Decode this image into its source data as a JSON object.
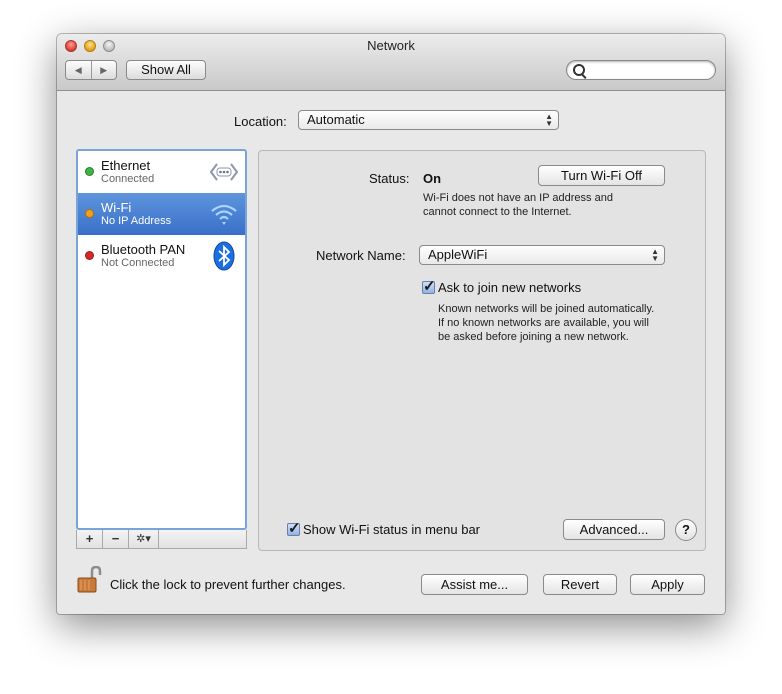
{
  "window": {
    "title": "Network",
    "nav_back": "◀",
    "nav_forward": "▶",
    "show_all_label": "Show All",
    "search_placeholder": ""
  },
  "location": {
    "label": "Location:",
    "value": "Automatic"
  },
  "services": [
    {
      "name": "Ethernet",
      "status": "Connected",
      "status_color": "#3fb33f",
      "icon": "ethernet-icon",
      "selected": false
    },
    {
      "name": "Wi-Fi",
      "status": "No IP Address",
      "status_color": "#f0a020",
      "icon": "wifi-icon",
      "selected": true
    },
    {
      "name": "Bluetooth PAN",
      "status": "Not Connected",
      "status_color": "#d62828",
      "icon": "bluetooth-icon",
      "selected": false
    }
  ],
  "list_toolbar": {
    "add": "+",
    "remove": "−",
    "action": "✲▾"
  },
  "detail": {
    "status_label": "Status:",
    "status_value": "On",
    "turn_off_label": "Turn Wi-Fi Off",
    "status_description_1": "Wi-Fi does not have an IP address and",
    "status_description_2": "cannot connect to the Internet.",
    "network_name_label": "Network Name:",
    "network_name_value": "AppleWiFi",
    "ask_join_label": "Ask to join new networks",
    "ask_join_checked": true,
    "ask_join_desc_1": "Known networks will be joined automatically.",
    "ask_join_desc_2": "If no known networks are available, you will",
    "ask_join_desc_3": "be asked before joining a new network.",
    "show_status_label": "Show Wi-Fi status in menu bar",
    "show_status_checked": true,
    "advanced_label": "Advanced...",
    "help_label": "?"
  },
  "footer": {
    "lock_text": "Click the lock to prevent further changes.",
    "assist_label": "Assist me...",
    "revert_label": "Revert",
    "apply_label": "Apply"
  },
  "colors": {
    "selection": "#4a82d3",
    "list_focus_ring": "#7aa3d8"
  }
}
